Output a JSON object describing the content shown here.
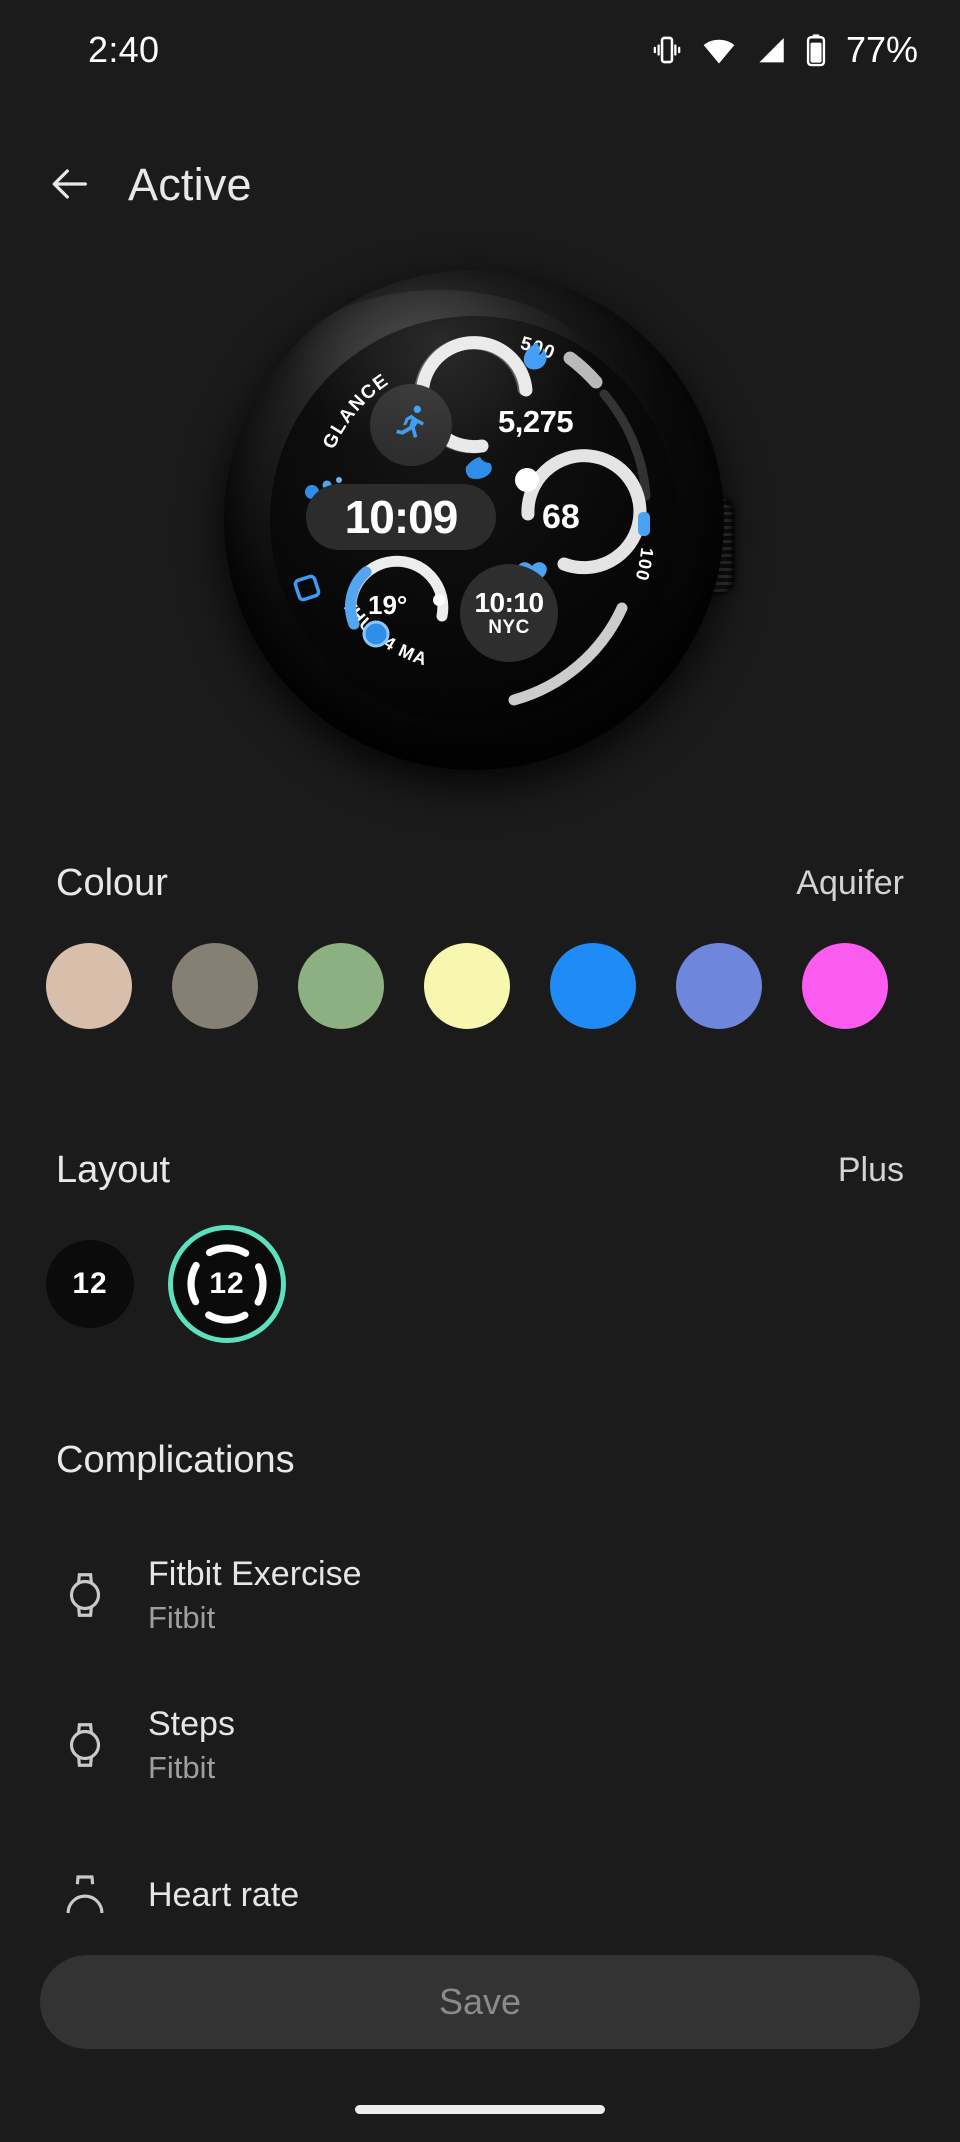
{
  "status_bar": {
    "time": "2:40",
    "battery_percent": "77%",
    "icons": [
      "vibrate-icon",
      "wifi-icon",
      "cellular-signal-icon",
      "battery-icon"
    ]
  },
  "header": {
    "back_icon": "arrow-left-icon",
    "title": "Active"
  },
  "watch_preview": {
    "name": "watch-face-preview",
    "time": "10:09",
    "steps": "5,275",
    "calories_goal": "500",
    "heart_rate": "68",
    "temperature": "19°",
    "world_clock_time": "10:10",
    "world_clock_city": "NYC",
    "date": "THU 24 MAY",
    "glance_label": "GLANCE",
    "battery_label": "100",
    "icons": [
      "running-person-icon",
      "flame-icon",
      "shoe-icon",
      "heart-icon",
      "globe-icon",
      "calendar-icon",
      "droplet-icon"
    ],
    "accent_color": "#3d9bf5"
  },
  "colour_section": {
    "title": "Colour",
    "selected_name": "Aquifer",
    "swatches": [
      {
        "name": "swatch-sand",
        "hex": "#d7bfab"
      },
      {
        "name": "swatch-taupe",
        "hex": "#857f74"
      },
      {
        "name": "swatch-sage",
        "hex": "#8cb081"
      },
      {
        "name": "swatch-butter",
        "hex": "#f8f7b0"
      },
      {
        "name": "swatch-aquifer",
        "hex": "#1f8bf7"
      },
      {
        "name": "swatch-periwinkle",
        "hex": "#6f86dd"
      },
      {
        "name": "swatch-magenta",
        "hex": "#fc5bf0"
      }
    ]
  },
  "layout_section": {
    "title": "Layout",
    "selected_name": "Plus",
    "options": [
      {
        "name": "layout-option-minimal",
        "label": "12",
        "selected": false
      },
      {
        "name": "layout-option-plus",
        "label": "12",
        "selected": true
      }
    ],
    "selection_color": "#5ce0bd"
  },
  "complications_section": {
    "title": "Complications",
    "items": [
      {
        "icon": "watch-icon",
        "name": "Fitbit Exercise",
        "provider": "Fitbit"
      },
      {
        "icon": "watch-icon",
        "name": "Steps",
        "provider": "Fitbit"
      },
      {
        "icon": "heart-rate-icon",
        "name": "Heart rate",
        "provider": ""
      }
    ]
  },
  "footer": {
    "save_label": "Save",
    "save_enabled": false
  }
}
